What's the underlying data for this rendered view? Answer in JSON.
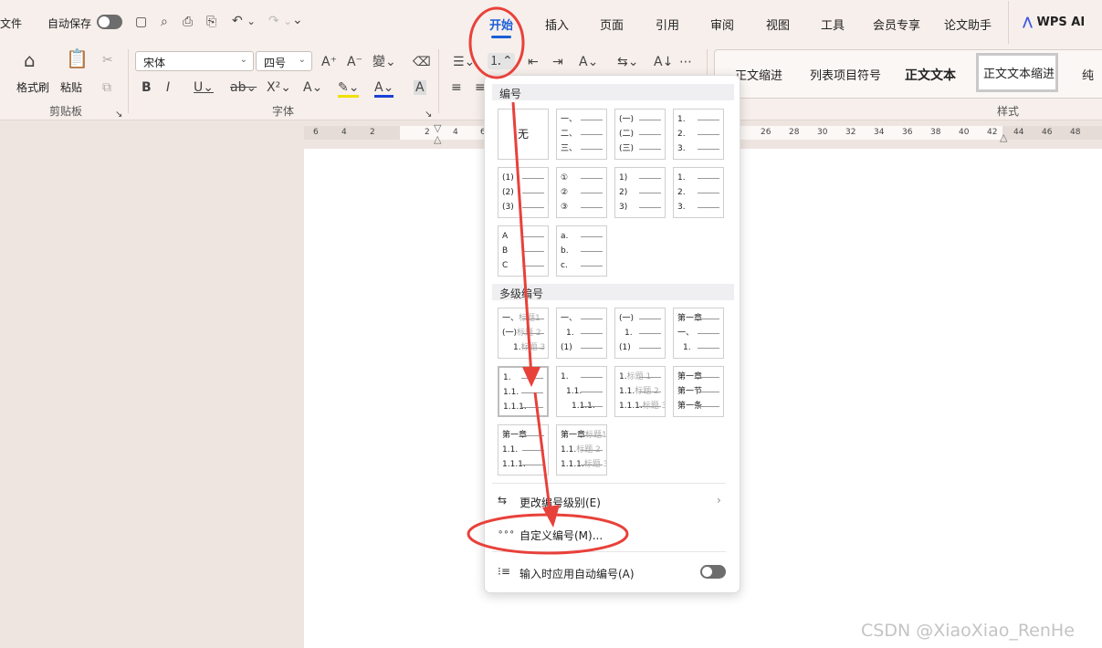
{
  "title_bar": {
    "file": "文件",
    "autosave": "自动保存"
  },
  "tabs": [
    "开始",
    "插入",
    "页面",
    "引用",
    "审阅",
    "视图",
    "工具",
    "会员专享",
    "论文助手",
    "WPS AI"
  ],
  "ribbon": {
    "format_painter": "格式刷",
    "paste": "粘贴",
    "clipboard": "剪贴板",
    "font_name": "宋体",
    "font_size": "四号",
    "font": "字体",
    "styles": "样式",
    "style_items": [
      "正文缩进",
      "列表项目符号",
      "正文文本",
      "正文文本缩进",
      "纯"
    ]
  },
  "ruler": [
    "6",
    "4",
    "2",
    "2",
    "4",
    "6",
    "26",
    "28",
    "30",
    "32",
    "34",
    "36",
    "38",
    "40",
    "42",
    "44",
    "46",
    "48"
  ],
  "menu": {
    "numbering": "编号",
    "none": "无",
    "num_cells": [
      [
        "一、",
        "二、",
        "三、"
      ],
      [
        "(一)",
        "(二)",
        "(三)"
      ],
      [
        "1.",
        "2.",
        "3."
      ],
      [
        "(1)",
        "(2)",
        "(3)"
      ],
      [
        "①",
        "②",
        "③"
      ],
      [
        "1)",
        "2)",
        "3)"
      ],
      [
        "1.",
        "2.",
        "3."
      ],
      [
        "A",
        "B",
        "C"
      ],
      [
        "a.",
        "b.",
        "c."
      ]
    ],
    "multilevel": "多级编号",
    "ml_cells": [
      [
        [
          "一、",
          "标题1"
        ],
        [
          "(一)",
          "标题 2"
        ],
        [
          "1.",
          "标题 3"
        ]
      ],
      [
        [
          "一、",
          ""
        ],
        [
          "1.",
          ""
        ],
        [
          "(1)",
          ""
        ]
      ],
      [
        [
          "(一)",
          ""
        ],
        [
          "1.",
          ""
        ],
        [
          "(1)",
          ""
        ]
      ],
      [
        [
          "第一章",
          ""
        ],
        [
          "一、",
          ""
        ],
        [
          "1.",
          ""
        ]
      ],
      [
        [
          "1.",
          ""
        ],
        [
          "1.1.",
          ""
        ],
        [
          "1.1.1.",
          ""
        ]
      ],
      [
        [
          "1.",
          ""
        ],
        [
          "1.1.",
          ""
        ],
        [
          "1.1.1.",
          ""
        ]
      ],
      [
        [
          "1.",
          "标题 1"
        ],
        [
          "1.1.",
          "标题 2"
        ],
        [
          "1.1.1.",
          "标题 3"
        ]
      ],
      [
        [
          "第一章",
          ""
        ],
        [
          "第一节",
          ""
        ],
        [
          "第一条",
          ""
        ]
      ],
      [
        [
          "第一章",
          ""
        ],
        [
          "1.1.",
          ""
        ],
        [
          "1.1.1.",
          ""
        ]
      ],
      [
        [
          "第一章",
          "标题1"
        ],
        [
          "1.1.",
          "标题 2"
        ],
        [
          "1.1.1.",
          "标题 3"
        ]
      ]
    ],
    "change_level": "更改编号级别(E)",
    "custom": "自定义编号(M)...",
    "auto_apply": "输入时应用自动编号(A)"
  },
  "watermark": "CSDN @XiaoXiao_RenHe",
  "colors": {
    "accent": "#1a5fd6",
    "annotation": "#e8413a"
  }
}
